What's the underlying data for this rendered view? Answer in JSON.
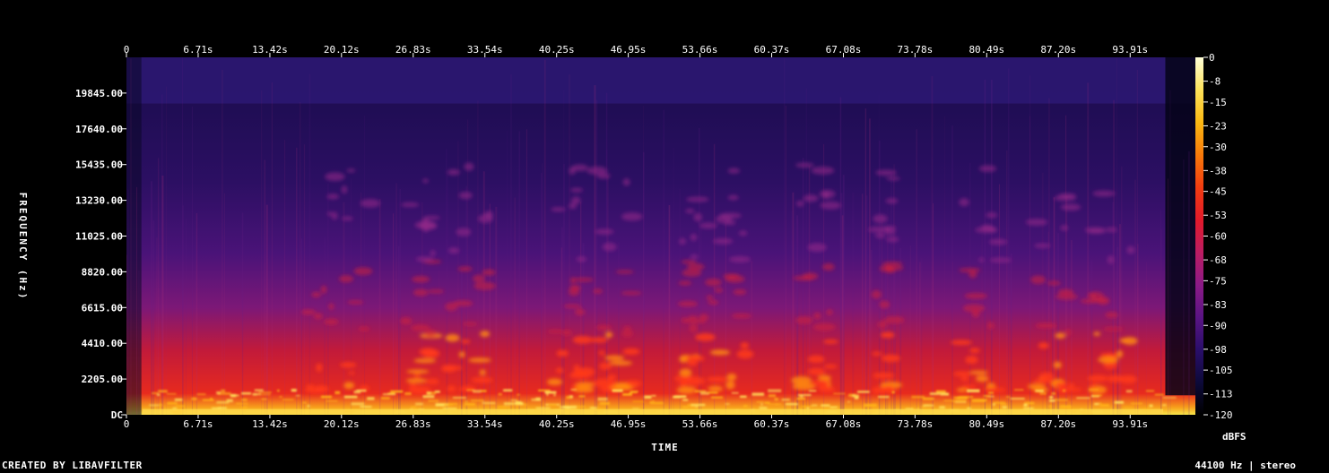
{
  "chart_data": {
    "type": "heatmap",
    "title": "",
    "xlabel": "TIME",
    "ylabel": "FREQUENCY (Hz)",
    "x_ticks": [
      "0",
      "6.71s",
      "13.42s",
      "20.12s",
      "26.83s",
      "33.54s",
      "40.25s",
      "46.95s",
      "53.66s",
      "60.37s",
      "67.08s",
      "73.78s",
      "80.49s",
      "87.20s",
      "93.91s"
    ],
    "x_range_seconds": [
      0,
      100.6
    ],
    "y_ticks": [
      "DC",
      "2205.00",
      "4410.00",
      "6615.00",
      "8820.00",
      "11025.00",
      "13230.00",
      "15435.00",
      "17640.00",
      "19845.00"
    ],
    "y_range_hz": [
      0,
      22050
    ],
    "colorbar": {
      "unit": "dBFS",
      "ticks": [
        "0",
        "-8",
        "-15",
        "-23",
        "-30",
        "-38",
        "-45",
        "-53",
        "-60",
        "-68",
        "-75",
        "-83",
        "-90",
        "-98",
        "-105",
        "-113",
        "-120"
      ],
      "range": [
        -120,
        0
      ],
      "colors": [
        "#000000",
        "#0d0a3a",
        "#2a0e6a",
        "#5a1484",
        "#8c1a86",
        "#bc1c62",
        "#e21a2a",
        "#f23c10",
        "#f87a0a",
        "#fbb812",
        "#fde25a",
        "#ffffd8"
      ]
    }
  },
  "footer": {
    "left": "CREATED BY LIBAVFILTER",
    "right": "44100 Hz | stereo"
  }
}
